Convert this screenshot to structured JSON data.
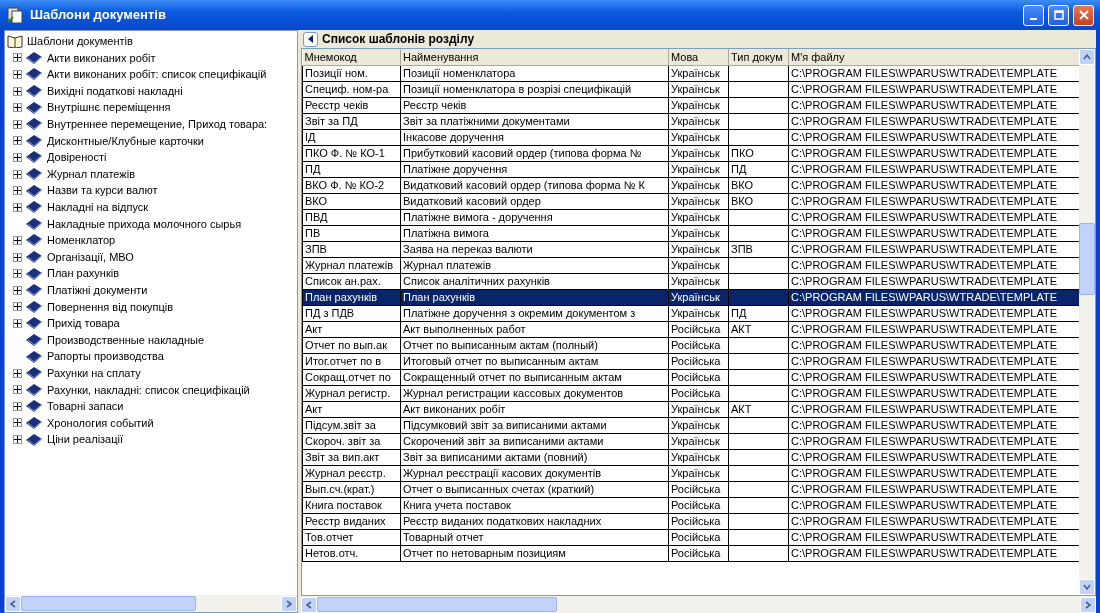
{
  "window": {
    "title": "Шаблони документів"
  },
  "tree": {
    "root": {
      "label": "Шаблони документів",
      "children": [
        {
          "label": "Акти виконаних робіт",
          "expandable": true
        },
        {
          "label": "Акти виконаних робіт: список специфікацій",
          "expandable": true
        },
        {
          "label": "Вихідні податкові накладні",
          "expandable": true
        },
        {
          "label": "Внутрішнє переміщення",
          "expandable": true
        },
        {
          "label": "Внутреннее перемещение, Приход товара:",
          "expandable": true
        },
        {
          "label": "Дисконтные/Клубные карточки",
          "expandable": true
        },
        {
          "label": "Довіреності",
          "expandable": true
        },
        {
          "label": "Журнал платежів",
          "expandable": true
        },
        {
          "label": "Назви та курси валют",
          "expandable": true
        },
        {
          "label": "Накладні на відпуск",
          "expandable": true
        },
        {
          "label": "Накладные прихода молочного сырья",
          "expandable": false
        },
        {
          "label": "Номенклатор",
          "expandable": true
        },
        {
          "label": "Організації, МВО",
          "expandable": true
        },
        {
          "label": "План рахунків",
          "expandable": true
        },
        {
          "label": "Платіжні документи",
          "expandable": true
        },
        {
          "label": "Повернення від покупців",
          "expandable": true
        },
        {
          "label": "Прихід товара",
          "expandable": true
        },
        {
          "label": "Производственные накладные",
          "expandable": false
        },
        {
          "label": "Рапорты производства",
          "expandable": false
        },
        {
          "label": "Рахунки на сплату",
          "expandable": true
        },
        {
          "label": "Рахунки, накладні: список специфікацій",
          "expandable": true
        },
        {
          "label": "Товарні запаси",
          "expandable": true
        },
        {
          "label": "Хронология событий",
          "expandable": true
        },
        {
          "label": "Ціни реалізації",
          "expandable": true
        }
      ]
    }
  },
  "table": {
    "title": "Список шаблонів розділу",
    "columns": [
      "Мнемокод",
      "Найменування",
      "Мова",
      "Тип докум",
      "М'я файлу"
    ],
    "rows": [
      {
        "mnemocode": "Позиції ном.",
        "name": "Позиції номенклатора",
        "language": "Українськ",
        "file_name": "C:\\PROGRAM FILES\\WPARUS\\WTRADE\\TEMPLATE",
        "selected": false
      },
      {
        "mnemocode": "Специф. ном-ра",
        "name": "Позиції номенклатора в розрізі специфікацій",
        "language": "Українськ",
        "file_name": "C:\\PROGRAM FILES\\WPARUS\\WTRADE\\TEMPLATE",
        "selected": false
      },
      {
        "mnemocode": "Реєстр чеків",
        "name": "Реєстр чеків",
        "language": "Українськ",
        "file_name": "C:\\PROGRAM FILES\\WPARUS\\WTRADE\\TEMPLATE",
        "selected": false
      },
      {
        "mnemocode": "Звіт за ПД",
        "name": "Звіт за платіжними документами",
        "language": "Українськ",
        "file_name": "C:\\PROGRAM FILES\\WPARUS\\WTRADE\\TEMPLATE",
        "selected": false
      },
      {
        "mnemocode": "ІД",
        "name": "Інкасове доручення",
        "language": "Українськ",
        "file_name": "C:\\PROGRAM FILES\\WPARUS\\WTRADE\\TEMPLATE",
        "selected": false
      },
      {
        "mnemocode": "ПКО Ф. № КО-1",
        "name": "Прибутковий касовий ордер (типова форма №",
        "language": "Українськ",
        "doc_type": "ПКО",
        "file_name": "C:\\PROGRAM FILES\\WPARUS\\WTRADE\\TEMPLATE",
        "selected": false
      },
      {
        "mnemocode": "ПД",
        "name": "Платіжне доручення",
        "language": "Українськ",
        "doc_type": "ПД",
        "file_name": "C:\\PROGRAM FILES\\WPARUS\\WTRADE\\TEMPLATE",
        "selected": false
      },
      {
        "mnemocode": "ВКО Ф. № КО-2",
        "name": "Видатковий касовий ордер (типова форма № К",
        "language": "Українськ",
        "doc_type": "ВКО",
        "file_name": "C:\\PROGRAM FILES\\WPARUS\\WTRADE\\TEMPLATE",
        "selected": false
      },
      {
        "mnemocode": "ВКО",
        "name": "Видатковий касовий ордер",
        "language": "Українськ",
        "doc_type": "ВКО",
        "file_name": "C:\\PROGRAM FILES\\WPARUS\\WTRADE\\TEMPLATE",
        "selected": false
      },
      {
        "mnemocode": "ПВД",
        "name": "Платіжне вимога - доручення",
        "language": "Українськ",
        "file_name": "C:\\PROGRAM FILES\\WPARUS\\WTRADE\\TEMPLATE",
        "selected": false
      },
      {
        "mnemocode": "ПВ",
        "name": "Платіжна вимога",
        "language": "Українськ",
        "file_name": "C:\\PROGRAM FILES\\WPARUS\\WTRADE\\TEMPLATE",
        "selected": false
      },
      {
        "mnemocode": "ЗПВ",
        "name": "Заява на переказ валюти",
        "language": "Українськ",
        "doc_type": "ЗПВ",
        "file_name": "C:\\PROGRAM FILES\\WPARUS\\WTRADE\\TEMPLATE",
        "selected": false
      },
      {
        "mnemocode": "Журнал платежів",
        "name": "Журнал платежів",
        "language": "Українськ",
        "file_name": "C:\\PROGRAM FILES\\WPARUS\\WTRADE\\TEMPLATE",
        "selected": false
      },
      {
        "mnemocode": "Список ан.рах.",
        "name": "Список аналітичних рахунків",
        "language": "Українськ",
        "file_name": "C:\\PROGRAM FILES\\WPARUS\\WTRADE\\TEMPLATE",
        "selected": false
      },
      {
        "mnemocode": "План рахунків",
        "name": "План рахунків",
        "language": "Українськ",
        "file_name": "C:\\PROGRAM FILES\\WPARUS\\WTRADE\\TEMPLATE",
        "selected": true
      },
      {
        "mnemocode": "ПД з ПДВ",
        "name": "Платіжне доручення з окремим документом з",
        "language": "Українськ",
        "doc_type": "ПД",
        "file_name": "C:\\PROGRAM FILES\\WPARUS\\WTRADE\\TEMPLATE",
        "selected": false
      },
      {
        "mnemocode": "Акт",
        "name": "Акт выполненных работ",
        "language": "Російська",
        "doc_type": "АКТ",
        "file_name": "C:\\PROGRAM FILES\\WPARUS\\WTRADE\\TEMPLATE",
        "selected": false
      },
      {
        "mnemocode": "Отчет по вып.ак",
        "name": "Отчет по выписанным актам (полный)",
        "language": "Російська",
        "file_name": "C:\\PROGRAM FILES\\WPARUS\\WTRADE\\TEMPLATE",
        "selected": false
      },
      {
        "mnemocode": "Итог.отчет по в",
        "name": "Итоговый отчет по выписанным актам",
        "language": "Російська",
        "file_name": "C:\\PROGRAM FILES\\WPARUS\\WTRADE\\TEMPLATE",
        "selected": false
      },
      {
        "mnemocode": "Сокращ.отчет по",
        "name": "Сокращенный отчет по выписанным актам",
        "language": "Російська",
        "file_name": "C:\\PROGRAM FILES\\WPARUS\\WTRADE\\TEMPLATE",
        "selected": false
      },
      {
        "mnemocode": "Журнал регистр.",
        "name": "Журнал регистрации кассовых документов",
        "language": "Російська",
        "file_name": "C:\\PROGRAM FILES\\WPARUS\\WTRADE\\TEMPLATE",
        "selected": false
      },
      {
        "mnemocode": "Акт",
        "name": "Акт виконаних робіт",
        "language": "Українськ",
        "doc_type": "АКТ",
        "file_name": "C:\\PROGRAM FILES\\WPARUS\\WTRADE\\TEMPLATE",
        "selected": false
      },
      {
        "mnemocode": "Підсум.звіт за",
        "name": "Підсумковий звіт за виписаними актами",
        "language": "Українськ",
        "file_name": "C:\\PROGRAM FILES\\WPARUS\\WTRADE\\TEMPLATE",
        "selected": false
      },
      {
        "mnemocode": "Скороч. звіт за",
        "name": "Скорочений звіт за виписаними актами",
        "language": "Українськ",
        "file_name": "C:\\PROGRAM FILES\\WPARUS\\WTRADE\\TEMPLATE",
        "selected": false
      },
      {
        "mnemocode": "Звіт за вип.акт",
        "name": "Звіт за виписаними актами (повний)",
        "language": "Українськ",
        "file_name": "C:\\PROGRAM FILES\\WPARUS\\WTRADE\\TEMPLATE",
        "selected": false
      },
      {
        "mnemocode": "Журнал реєстр.",
        "name": "Журнал реєстрації касових документів",
        "language": "Українськ",
        "file_name": "C:\\PROGRAM FILES\\WPARUS\\WTRADE\\TEMPLATE",
        "selected": false
      },
      {
        "mnemocode": "Вып.сч.(крат.)",
        "name": "Отчет о выписанных счетах (краткий)",
        "language": "Російська",
        "file_name": "C:\\PROGRAM FILES\\WPARUS\\WTRADE\\TEMPLATE",
        "selected": false
      },
      {
        "mnemocode": "Книга поставок",
        "name": "Книга учета поставок",
        "language": "Російська",
        "file_name": "C:\\PROGRAM FILES\\WPARUS\\WTRADE\\TEMPLATE",
        "selected": false
      },
      {
        "mnemocode": "Реєстр виданих",
        "name": "Реєстр виданих податкових накладних",
        "language": "Російська",
        "file_name": "C:\\PROGRAM FILES\\WPARUS\\WTRADE\\TEMPLATE",
        "selected": false
      },
      {
        "mnemocode": "Тов.отчет",
        "name": "Товарный отчет",
        "language": "Російська",
        "file_name": "C:\\PROGRAM FILES\\WPARUS\\WTRADE\\TEMPLATE",
        "selected": false
      },
      {
        "mnemocode": "Нетов.отч.",
        "name": "Отчет по нетоварным позициям",
        "language": "Російська",
        "file_name": "C:\\PROGRAM FILES\\WPARUS\\WTRADE\\TEMPLATE",
        "selected": false
      }
    ]
  }
}
